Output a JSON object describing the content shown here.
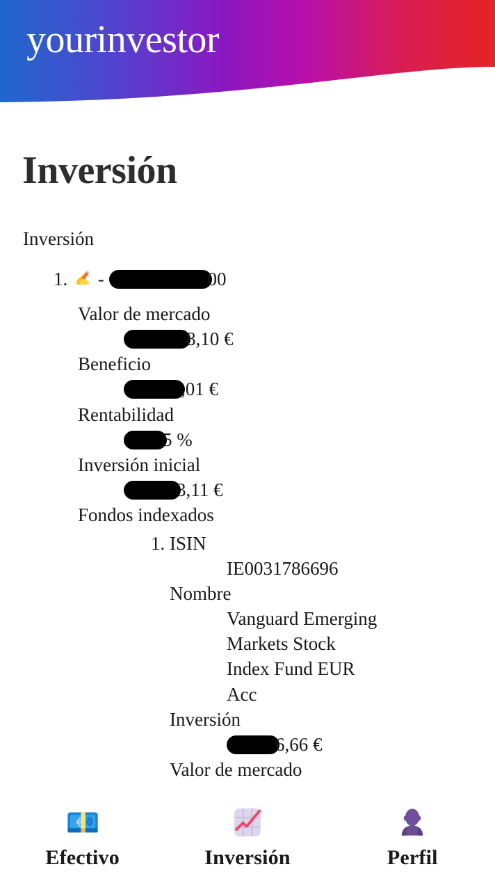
{
  "brand": {
    "name": "yourinvestor"
  },
  "header_colors": {
    "gradient_start": "#1f68cc",
    "gradient_mid": "#a511b8",
    "gradient_end": "#e42424"
  },
  "page": {
    "title": "Inversión",
    "section_label": "Inversión"
  },
  "investment": {
    "index": "1.",
    "icon": "writing-hand-emoji",
    "separator": "-",
    "account_redacted": true,
    "account_suffix": "00",
    "fields": [
      {
        "label": "Valor de mercado",
        "value_suffix": "8,10 €",
        "redacted_width": 96
      },
      {
        "label": "Beneficio",
        "value_suffix": ",01 €",
        "redacted_width": 88
      },
      {
        "label": "Rentabilidad",
        "value_suffix": "5 %",
        "redacted_width": 62
      },
      {
        "label": "Inversión inicial",
        "value_suffix": "3,11 €",
        "redacted_width": 82
      }
    ],
    "funds_label": "Fondos indexados",
    "funds": [
      {
        "index": "1.",
        "isin_label": "ISIN",
        "isin_value": "IE0031786696",
        "name_label": "Nombre",
        "name_value": "Vanguard Emerging Markets Stock Index Fund EUR Acc",
        "investment_label": "Inversión",
        "investment_value_suffix": "6,66 €",
        "investment_redacted_width": 76,
        "market_value_label": "Valor de mercado"
      }
    ]
  },
  "navbar": {
    "items": [
      {
        "label": "Efectivo",
        "icon": "euro-banknote-icon"
      },
      {
        "label": "Inversión",
        "icon": "chart-increasing-icon"
      },
      {
        "label": "Perfil",
        "icon": "person-silhouette-icon"
      }
    ]
  }
}
